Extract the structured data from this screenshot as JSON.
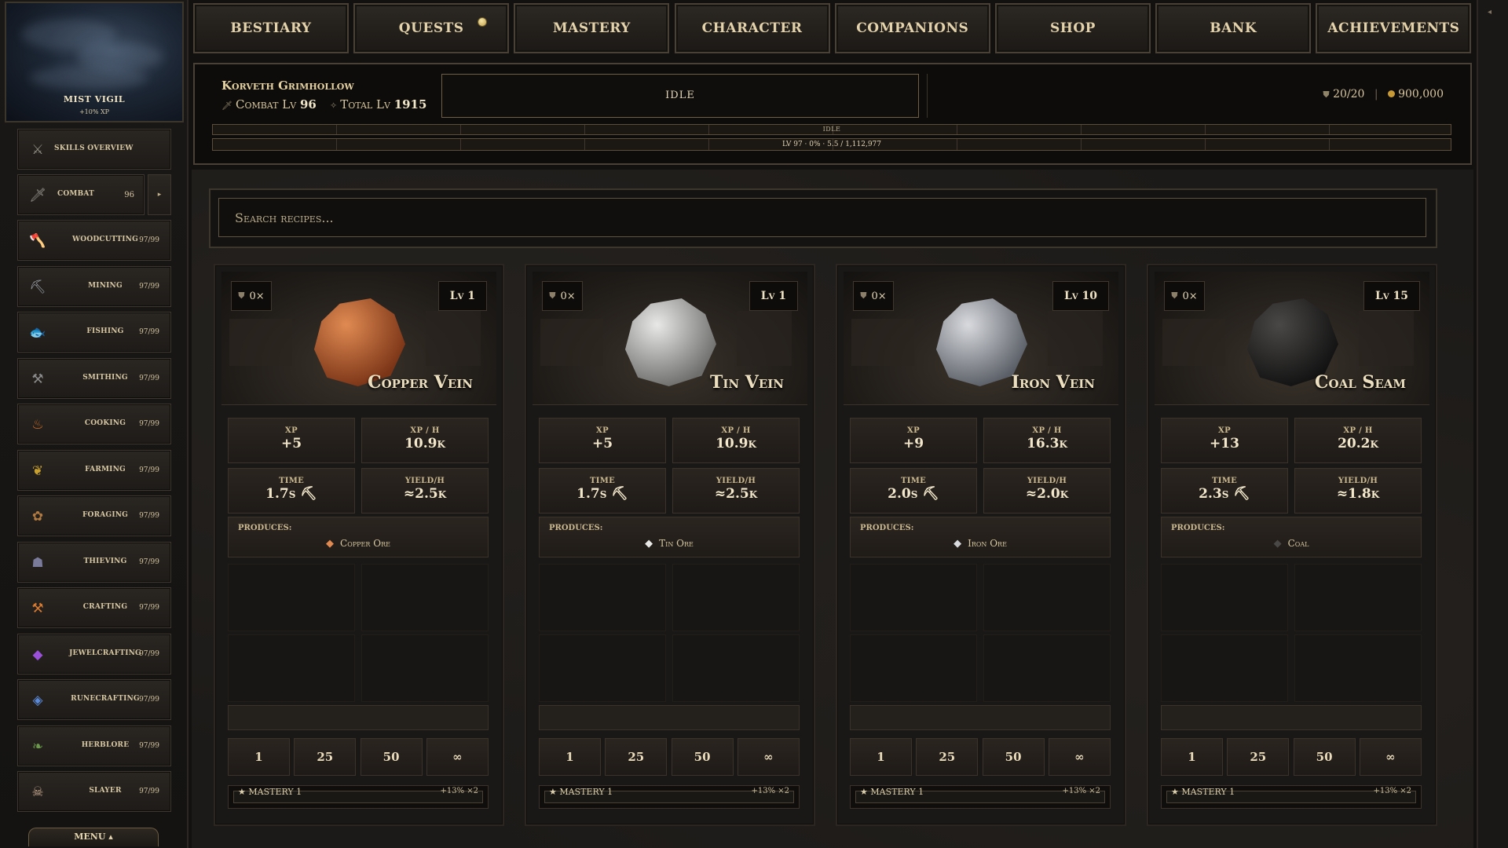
{
  "location": {
    "name": "MIST VIGIL",
    "bonus": "+10% XP"
  },
  "sidebar": {
    "overview": {
      "label": "Skills Overview",
      "icon": "crossed-swords-icon"
    },
    "combat": {
      "label": "Combat",
      "level": "96",
      "expand": "▸",
      "icon": "sword-icon"
    },
    "skills": [
      {
        "label": "Woodcutting",
        "level": "97/99",
        "icon": "axe-icon"
      },
      {
        "label": "Mining",
        "level": "97/99",
        "icon": "pickaxe-icon"
      },
      {
        "label": "Fishing",
        "level": "97/99",
        "icon": "fish-icon"
      },
      {
        "label": "Smithing",
        "level": "97/99",
        "icon": "anvil-icon"
      },
      {
        "label": "Cooking",
        "level": "97/99",
        "icon": "pot-icon"
      },
      {
        "label": "Farming",
        "level": "97/99",
        "icon": "wheat-icon"
      },
      {
        "label": "Foraging",
        "level": "97/99",
        "icon": "herb-icon"
      },
      {
        "label": "Thieving",
        "level": "97/99",
        "icon": "mask-icon"
      },
      {
        "label": "Crafting",
        "level": "97/99",
        "icon": "hammer-icon"
      },
      {
        "label": "Jewelcrafting",
        "level": "97/99",
        "icon": "gem-icon"
      },
      {
        "label": "Runecrafting",
        "level": "97/99",
        "icon": "rune-icon"
      },
      {
        "label": "Herblore",
        "level": "97/99",
        "icon": "leaf-icon"
      },
      {
        "label": "Slayer",
        "level": "97/99",
        "icon": "skull-icon"
      }
    ],
    "menu_label": "MENU ▴"
  },
  "nav": {
    "tabs": [
      "BESTIARY",
      "QUESTS",
      "MASTERY",
      "CHARACTER",
      "COMPANIONS",
      "SHOP",
      "BANK",
      "ACHIEVEMENTS"
    ],
    "rail_arrow": "◂"
  },
  "player": {
    "name": "Korveth Grimhollow",
    "combat_label": "Combat Lv",
    "combat_level": "96",
    "total_label": "Total Lv",
    "total_level": "1915",
    "activity": "IDLE",
    "inventory": "20/20",
    "gold": "900,000",
    "action_bar_text": "IDLE",
    "xp_bar_text": "LV 97 · 0% · 5.5 / 1,112,977",
    "xp_progress_fraction": 0
  },
  "search": {
    "placeholder": "Search recipes..."
  },
  "stat_labels": {
    "xp": "XP",
    "xph": "XP / H",
    "time": "TIME",
    "yield": "YIELD/H",
    "produces": "PRODUCES:"
  },
  "quantities": [
    "1",
    "25",
    "50",
    "∞"
  ],
  "recipes": [
    {
      "owned": "0×",
      "level": "Lv 1",
      "name": "Copper Vein",
      "xp": "+5",
      "xph": "10.9k",
      "time": "1.7s ⛏",
      "yield": "≈2.5k",
      "product": "Copper Ore",
      "product_icon": "copper-ore-icon",
      "mastery": "★ MASTERY 1",
      "mastery_bonus": "+13% ×2",
      "ore_color_a": "#e08a52",
      "ore_color_b": "#7a3416"
    },
    {
      "owned": "0×",
      "level": "Lv 1",
      "name": "Tin Vein",
      "xp": "+5",
      "xph": "10.9k",
      "time": "1.7s ⛏",
      "yield": "≈2.5k",
      "product": "Tin Ore",
      "product_icon": "tin-ore-icon",
      "mastery": "★ MASTERY 1",
      "mastery_bonus": "+13% ×2",
      "ore_color_a": "#e8e8e6",
      "ore_color_b": "#6e6e6c"
    },
    {
      "owned": "0×",
      "level": "Lv 10",
      "name": "Iron Vein",
      "xp": "+9",
      "xph": "16.3k",
      "time": "2.0s ⛏",
      "yield": "≈2.0k",
      "product": "Iron Ore",
      "product_icon": "iron-ore-icon",
      "mastery": "★ MASTERY 1",
      "mastery_bonus": "+13% ×2",
      "ore_color_a": "#d8dade",
      "ore_color_b": "#5a5e66"
    },
    {
      "owned": "0×",
      "level": "Lv 15",
      "name": "Coal Seam",
      "xp": "+13",
      "xph": "20.2k",
      "time": "2.3s ⛏",
      "yield": "≈1.8k",
      "product": "Coal",
      "product_icon": "coal-icon",
      "mastery": "★ MASTERY 1",
      "mastery_bonus": "+13% ×2",
      "ore_color_a": "#4a4846",
      "ore_color_b": "#121212"
    }
  ]
}
